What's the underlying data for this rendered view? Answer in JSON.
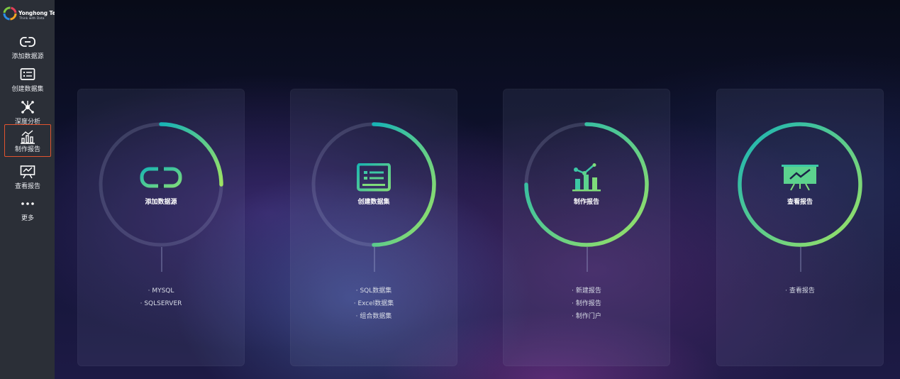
{
  "brand": {
    "name": "Yonghong Tech",
    "tagline": "Think with Data"
  },
  "sidebar": {
    "items": [
      {
        "label": "添加数据源",
        "icon": "link-icon",
        "active": false
      },
      {
        "label": "创建数据集",
        "icon": "dataset-icon",
        "active": false
      },
      {
        "label": "深度分析",
        "icon": "network-icon",
        "active": false
      },
      {
        "label": "制作报告",
        "icon": "bar-chart-icon",
        "active": true
      },
      {
        "label": "查看报告",
        "icon": "presentation-icon",
        "active": false
      },
      {
        "label": "更多",
        "icon": "more-icon",
        "active": false
      }
    ]
  },
  "cards": [
    {
      "title": "添加数据源",
      "icon": "link-icon",
      "progress": 0.25,
      "links": [
        "· MYSQL",
        "· SQLSERVER"
      ]
    },
    {
      "title": "创建数据集",
      "icon": "dataset-icon",
      "progress": 0.5,
      "links": [
        "· SQL数据集",
        "· Excel数据集",
        "· 组合数据集"
      ]
    },
    {
      "title": "制作报告",
      "icon": "bar-chart-icon",
      "progress": 0.75,
      "links": [
        "· 新建报告",
        "· 制作报告",
        "· 制作门户"
      ]
    },
    {
      "title": "查看报告",
      "icon": "presentation-icon",
      "progress": 1.0,
      "links": [
        "· 查看报告"
      ]
    }
  ],
  "colors": {
    "arc_start": "#17b3b6",
    "arc_end": "#9ee363",
    "icon": "#3cc8a5",
    "active_border": "#e2542f"
  }
}
